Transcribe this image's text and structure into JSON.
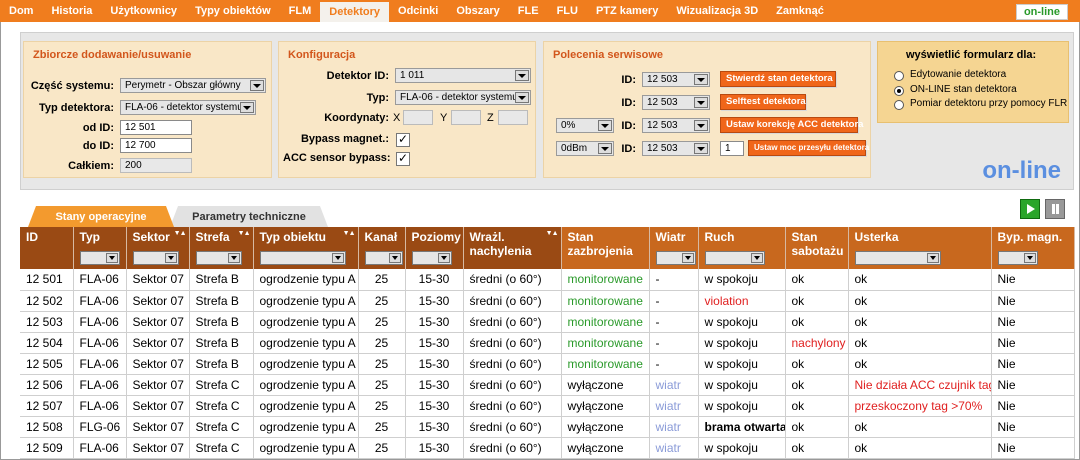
{
  "nav": {
    "items": [
      "Dom",
      "Historia",
      "Użytkownicy",
      "Typy obiektów",
      "FLM",
      "Detektory",
      "Odcinki",
      "Obszary",
      "FLE",
      "FLU",
      "PTZ kamery",
      "Wizualizacja 3D",
      "Zamknąć"
    ],
    "active": "Detektory",
    "status_badge": "on-line"
  },
  "panel1": {
    "title": "Zbiorcze dodawanie/usuwanie",
    "czesc_label": "Część systemu:",
    "czesc_value": "Perymetr - Obszar główny",
    "typ_label": "Typ detektora:",
    "typ_value": "FLA-06 - detektor systemu",
    "od_label": "od ID:",
    "od_value": "12 501",
    "do_label": "do ID:",
    "do_value": "12 700",
    "calkiem_label": "Całkiem:",
    "calkiem_value": "200"
  },
  "panel2": {
    "title": "Konfiguracja",
    "detektor_label": "Detektor ID:",
    "detektor_value": "1 011",
    "typ_label": "Typ:",
    "typ_value": "FLA-06 - detektor systemu",
    "koord_label": "Koordynaty:",
    "x_label": "X",
    "y_label": "Y",
    "z_label": "Z",
    "bypass_label": "Bypass magnet.:",
    "acc_label": "ACC sensor bypass:",
    "check_mark": "✓"
  },
  "panel3": {
    "title": "Polecenia serwisowe",
    "id_label": "ID:",
    "rows": [
      {
        "pre": "",
        "id": "12 503",
        "button": "Stwierdź stan detektora"
      },
      {
        "pre": "",
        "id": "12 503",
        "button": "Selftest detektora"
      },
      {
        "pre": "0%",
        "id": "12 503",
        "button": "Ustaw korekcję ACC detektora"
      },
      {
        "pre": "0dBm",
        "id": "12 503",
        "extra": "1",
        "button": "Ustaw moc przesyłu detektora"
      }
    ]
  },
  "panel4": {
    "title": "wyświetlić formularz dla:",
    "options": [
      "Edytowanie detektora",
      "ON-LINE stan detektora",
      "Pomiar detektoru przy pomocy FLR"
    ],
    "selected_index": 1
  },
  "status_big": "on-line",
  "tabs": [
    "Stany operacyjne",
    "Parametry techniczne"
  ],
  "table": {
    "headers": [
      "ID",
      "Typ",
      "Sektor",
      "Strefa",
      "Typ obiektu",
      "Kanał",
      "Poziomy",
      "Wrażl. nachylenia",
      "Stan zazbrojenia",
      "Wiatr",
      "Ruch",
      "Stan sabotażu",
      "Usterka",
      "Byp. magn."
    ],
    "rows": [
      [
        "12 501",
        "FLA-06",
        "Sektor 07",
        "Strefa B",
        "ogrodzenie typu A",
        "25",
        "15-30",
        "średni (o 60°)",
        "monitorowane",
        "-",
        "w spokoju",
        "ok",
        "ok",
        "Nie"
      ],
      [
        "12 502",
        "FLA-06",
        "Sektor 07",
        "Strefa B",
        "ogrodzenie typu A",
        "25",
        "15-30",
        "średni (o 60°)",
        "monitorowane",
        "-",
        "violation",
        "ok",
        "ok",
        "Nie"
      ],
      [
        "12 503",
        "FLA-06",
        "Sektor 07",
        "Strefa B",
        "ogrodzenie typu A",
        "25",
        "15-30",
        "średni (o 60°)",
        "monitorowane",
        "-",
        "w spokoju",
        "ok",
        "ok",
        "Nie"
      ],
      [
        "12 504",
        "FLA-06",
        "Sektor 07",
        "Strefa B",
        "ogrodzenie typu A",
        "25",
        "15-30",
        "średni (o 60°)",
        "monitorowane",
        "-",
        "w spokoju",
        "nachylony",
        "ok",
        "Nie"
      ],
      [
        "12 505",
        "FLA-06",
        "Sektor 07",
        "Strefa B",
        "ogrodzenie typu A",
        "25",
        "15-30",
        "średni (o 60°)",
        "monitorowane",
        "-",
        "w spokoju",
        "ok",
        "ok",
        "Nie"
      ],
      [
        "12 506",
        "FLA-06",
        "Sektor 07",
        "Strefa C",
        "ogrodzenie typu A",
        "25",
        "15-30",
        "średni (o 60°)",
        "wyłączone",
        "wiatr",
        "w spokoju",
        "ok",
        "Nie działa ACC czujnik tagu",
        "Nie"
      ],
      [
        "12 507",
        "FLA-06",
        "Sektor 07",
        "Strefa C",
        "ogrodzenie typu A",
        "25",
        "15-30",
        "średni (o 60°)",
        "wyłączone",
        "wiatr",
        "w spokoju",
        "ok",
        "przeskoczony tag >70%",
        "Nie"
      ],
      [
        "12 508",
        "FLG-06",
        "Sektor 07",
        "Strefa C",
        "ogrodzenie typu A",
        "25",
        "15-30",
        "średni (o 60°)",
        "wyłączone",
        "wiatr",
        "brama otwarta",
        "ok",
        "ok",
        "Nie"
      ],
      [
        "12 509",
        "FLA-06",
        "Sektor 07",
        "Strefa C",
        "ogrodzenie typu A",
        "25",
        "15-30",
        "średni (o 60°)",
        "wyłączone",
        "wiatr",
        "w spokoju",
        "ok",
        "ok",
        "Nie"
      ]
    ]
  },
  "colors": {
    "accent": "#f07d1e",
    "header_dark": "#9a4a14",
    "header_alt": "#c8681e",
    "ok_green": "#2a9a2a",
    "alert_red": "#e02020",
    "wind_blue": "#8a9bd8",
    "online_blue": "#5b8fe0"
  }
}
